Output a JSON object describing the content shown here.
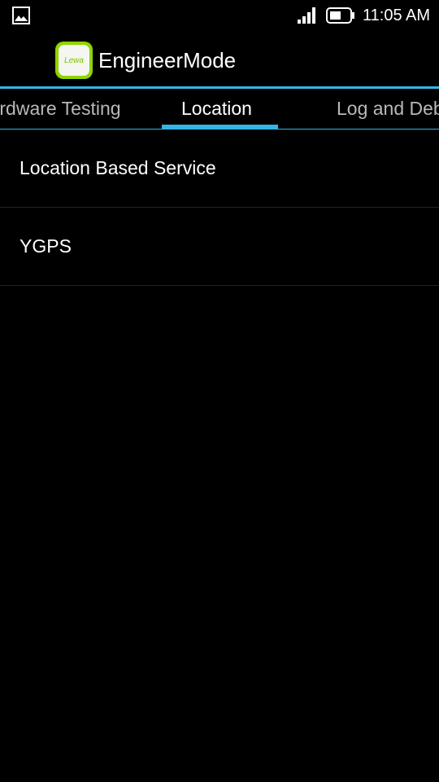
{
  "status_bar": {
    "time": "11:05 AM",
    "left_icon": "image-icon",
    "signal_icon": "signal-icon",
    "battery_icon": "battery-icon"
  },
  "action_bar": {
    "app_icon_text": "Lewa",
    "title": "EngineerMode"
  },
  "tabs": [
    {
      "label": "Hardware Testing",
      "selected": false
    },
    {
      "label": "Location",
      "selected": true
    },
    {
      "label": "Log and Debugging",
      "selected": false
    }
  ],
  "list": {
    "items": [
      {
        "label": "Location Based Service"
      },
      {
        "label": "YGPS"
      }
    ]
  },
  "colors": {
    "accent": "#33b5e5",
    "background": "#000000",
    "app_icon_green": "#8fd400"
  }
}
